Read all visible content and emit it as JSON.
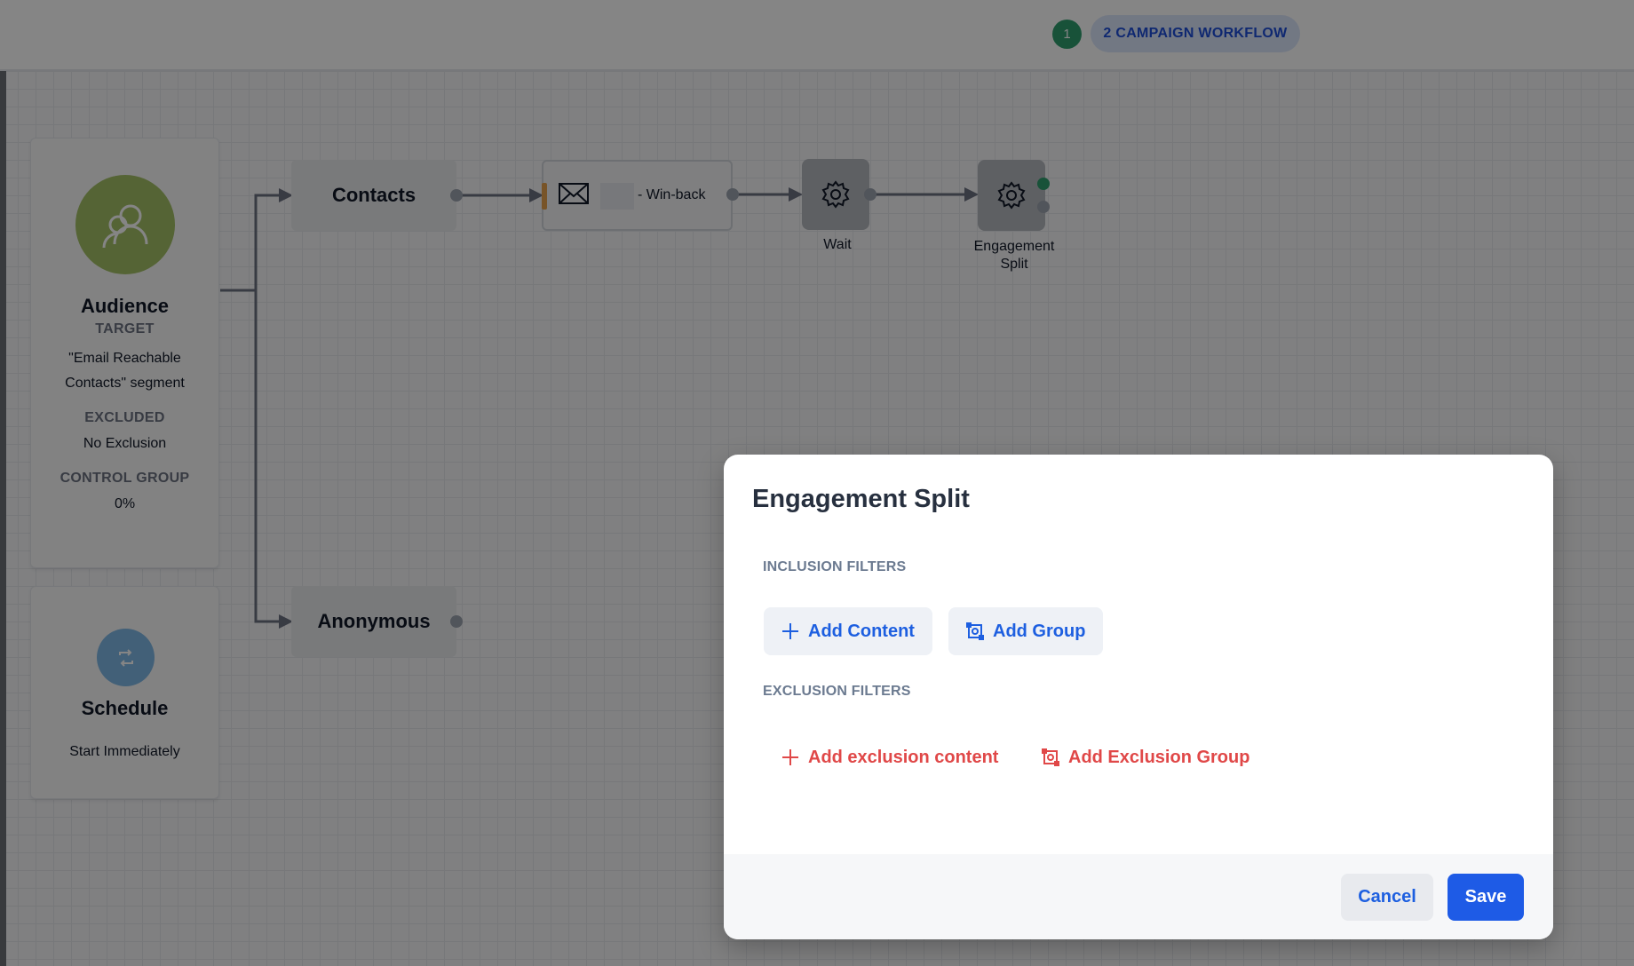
{
  "header": {
    "step_number": "1",
    "current_step": "2 CAMPAIGN WORKFLOW"
  },
  "audience": {
    "title": "Audience",
    "target_label": "TARGET",
    "target_line1": "\"Email Reachable",
    "target_line2": "Contacts\" segment",
    "excluded_label": "EXCLUDED",
    "excluded_value": "No Exclusion",
    "control_label": "CONTROL GROUP",
    "control_value": "0%",
    "icon": "users-icon"
  },
  "schedule": {
    "title": "Schedule",
    "value": "Start Immediately",
    "icon": "repeat-icon"
  },
  "workflow": {
    "contacts_label": "Contacts",
    "anonymous_label": "Anonymous",
    "email_label": "- Win-back",
    "wait_label": "Wait",
    "split_label_line1": "Engagement",
    "split_label_line2": "Split"
  },
  "modal": {
    "title": "Engagement Split",
    "inclusion_label": "INCLUSION FILTERS",
    "add_content": "Add Content",
    "add_group": "Add Group",
    "exclusion_label": "EXCLUSION FILTERS",
    "add_exclusion_content": "Add exclusion content",
    "add_exclusion_group": "Add Exclusion Group",
    "cancel": "Cancel",
    "save": "Save"
  },
  "colors": {
    "primary": "#1e5be6",
    "danger": "#e04848",
    "success": "#2f9e6e",
    "audience_avatar": "#a3c066",
    "schedule_avatar": "#7fb8e6"
  }
}
